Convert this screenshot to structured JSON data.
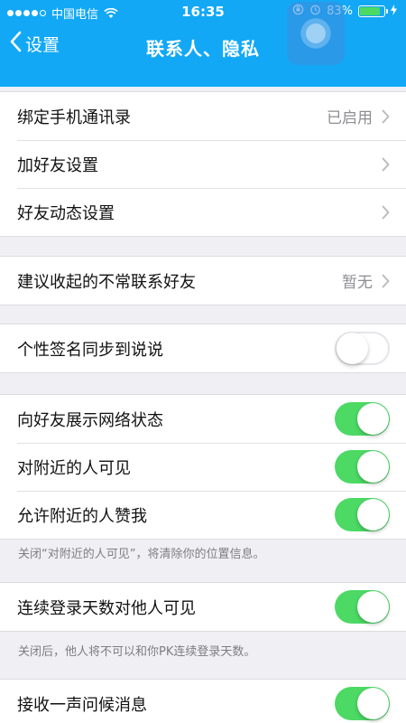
{
  "status_bar": {
    "carrier": "中国电信",
    "time": "16:35",
    "battery_percent": "83%",
    "battery_level": 0.83,
    "signal_dots_filled": 4
  },
  "nav": {
    "back_label": "设置",
    "title": "联系人、隐私"
  },
  "groups": {
    "contacts": {
      "bind_contacts": {
        "label": "绑定手机通讯录",
        "value": "已启用"
      },
      "add_friend": {
        "label": "加好友设置"
      },
      "friend_feed": {
        "label": "好友动态设置"
      }
    },
    "suggest": {
      "label": "建议收起的不常联系好友",
      "value": "暂无"
    },
    "signature": {
      "label": "个性签名同步到说说",
      "on": false
    },
    "presence": {
      "network_status": {
        "label": "向好友展示网络状态",
        "on": true
      },
      "nearby_visible": {
        "label": "对附近的人可见",
        "on": true
      },
      "nearby_like": {
        "label": "允许附近的人赞我",
        "on": true
      },
      "note": "关闭“对附近的人可见”，将清除你的位置信息。"
    },
    "login_days": {
      "label": "连续登录天数对他人可见",
      "on": true,
      "note": "关闭后，他人将不可以和你PK连续登录天数。"
    },
    "greeting": {
      "label": "接收一声问候消息",
      "on": true
    }
  },
  "colors": {
    "nav_bg": "#12a8f6",
    "toggle_on": "#4cd964",
    "page_bg": "#efeff4"
  }
}
